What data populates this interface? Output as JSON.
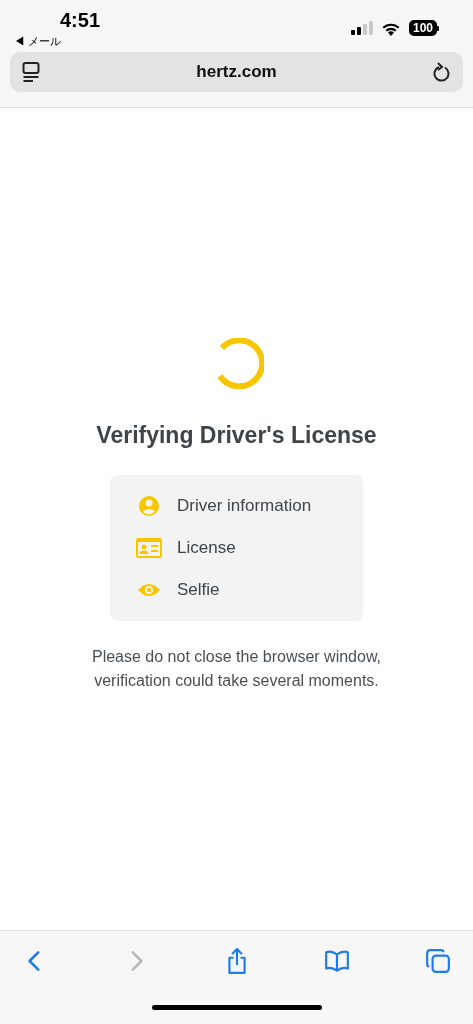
{
  "status_bar": {
    "time": "4:51",
    "back_label": "◀ メール",
    "battery": "100"
  },
  "address_bar": {
    "url": "hertz.com"
  },
  "page": {
    "title": "Verifying Driver's License",
    "steps": [
      {
        "kind": "person",
        "label": "Driver information"
      },
      {
        "kind": "license",
        "label": "License"
      },
      {
        "kind": "eye",
        "label": "Selfie"
      }
    ],
    "message": "Please do not close the browser window, verification could take several moments."
  },
  "toolbar": [
    {
      "kind": "back",
      "disabled": false
    },
    {
      "kind": "forward",
      "disabled": true
    },
    {
      "kind": "share",
      "disabled": false
    },
    {
      "kind": "bookmarks",
      "disabled": false
    },
    {
      "kind": "tabs",
      "disabled": false
    }
  ]
}
